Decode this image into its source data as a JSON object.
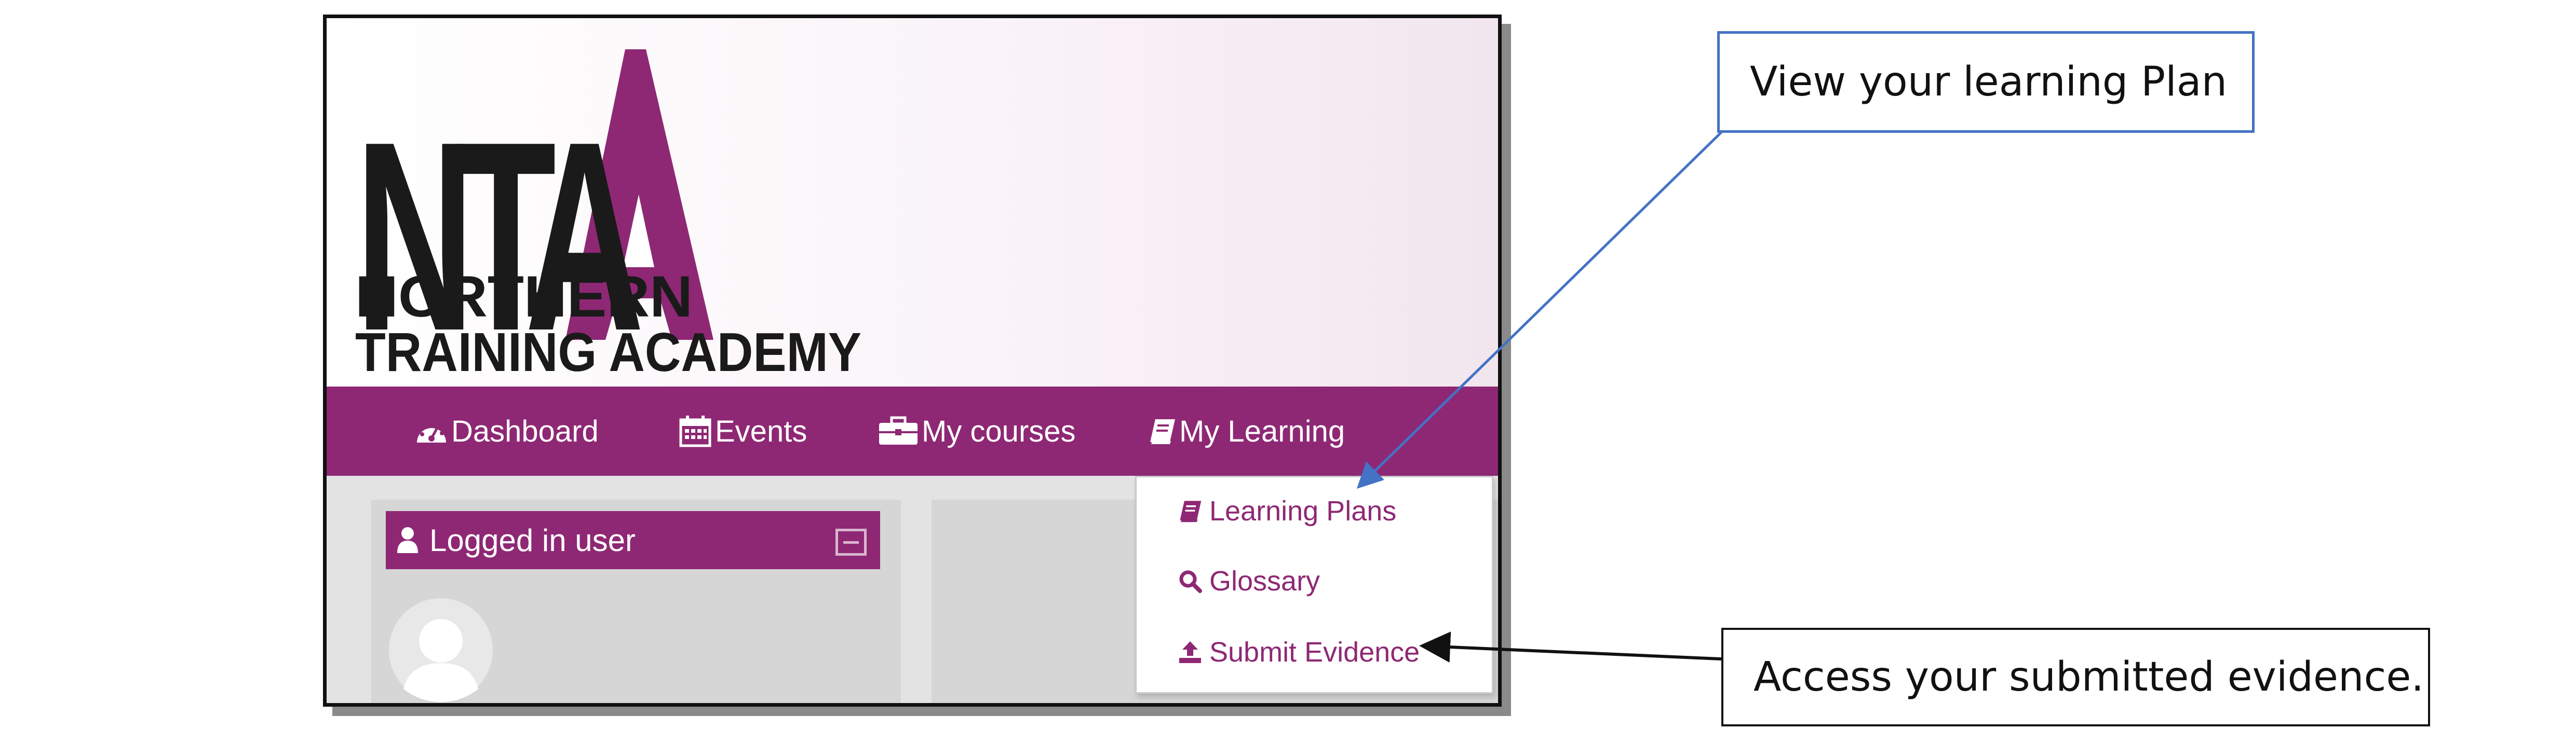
{
  "logo": {
    "letters": "NTA",
    "line1": "NORTHERN",
    "line2": "TRAINING ACADEMY",
    "brand_color": "#8e2874",
    "dark_color": "#1a1a1a"
  },
  "nav": {
    "items": [
      {
        "label": "Dashboard",
        "icon": "dashboard-icon"
      },
      {
        "label": "Events",
        "icon": "calendar-icon"
      },
      {
        "label": "My courses",
        "icon": "briefcase-icon"
      },
      {
        "label": "My Learning",
        "icon": "book-icon"
      }
    ]
  },
  "dropdown": {
    "items": [
      {
        "label": "Learning Plans",
        "icon": "book-icon"
      },
      {
        "label": "Glossary",
        "icon": "search-icon"
      },
      {
        "label": "Submit Evidence",
        "icon": "upload-icon"
      }
    ]
  },
  "block": {
    "title": "Logged in user",
    "title_icon": "user-icon"
  },
  "callouts": {
    "top": "View your learning Plan",
    "bottom": "Access your submitted evidence."
  },
  "colors": {
    "accent": "#8e2874",
    "callout_border": "#4472c4",
    "arrow_blue": "#4472c4",
    "arrow_black": "#111111"
  }
}
